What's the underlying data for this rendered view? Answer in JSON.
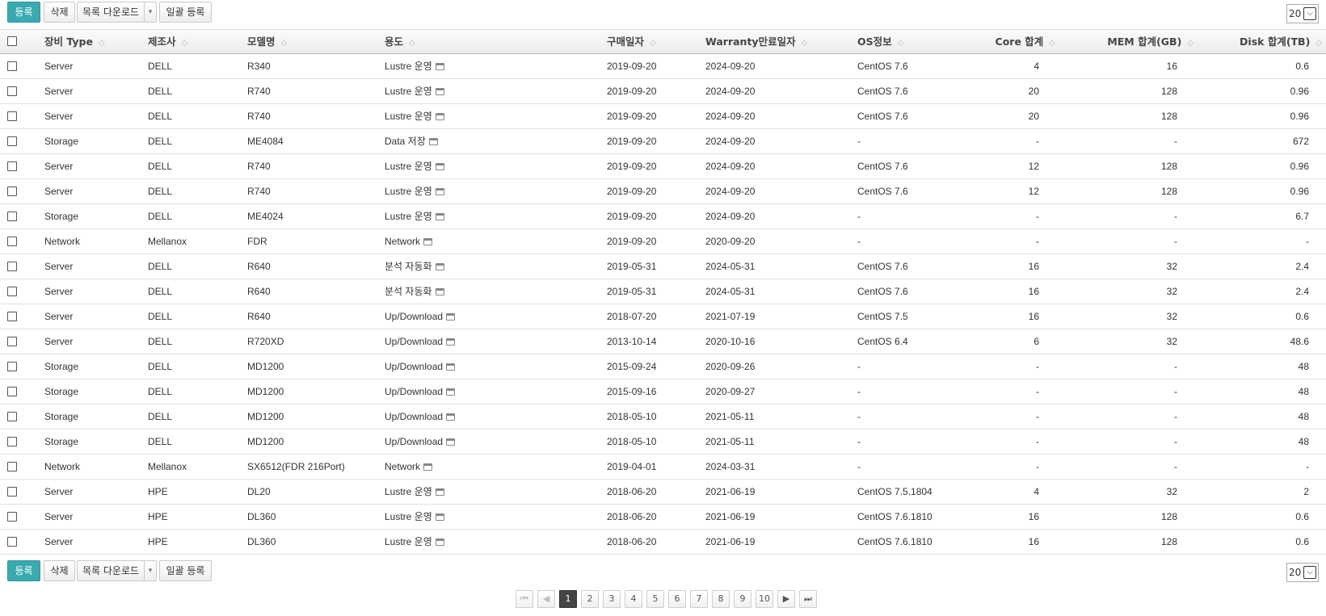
{
  "toolbar": {
    "register_label": "등록",
    "delete_label": "삭제",
    "download_label": "목록 다운로드",
    "download_caret": "▾",
    "bulk_label": "일괄 등록",
    "page_size": "20",
    "page_size_arrow": "⌵"
  },
  "table": {
    "sort_icon": "◇",
    "headers": {
      "type": "장비 Type",
      "maker": "제조사",
      "model": "모델명",
      "usage": "용도",
      "purchase": "구매일자",
      "warranty": "Warranty만료일자",
      "os": "OS정보",
      "core": "Core 합계",
      "mem": "MEM 합계(GB)",
      "disk": "Disk 합계(TB)"
    },
    "rows": [
      {
        "type": "Server",
        "maker": "DELL",
        "model": "R340",
        "usage": "Lustre 운영",
        "purchase": "2019-09-20",
        "warranty": "2024-09-20",
        "os": "CentOS 7.6",
        "core": "4",
        "mem": "16",
        "disk": "0.6"
      },
      {
        "type": "Server",
        "maker": "DELL",
        "model": "R740",
        "usage": "Lustre 운영",
        "purchase": "2019-09-20",
        "warranty": "2024-09-20",
        "os": "CentOS 7.6",
        "core": "20",
        "mem": "128",
        "disk": "0.96"
      },
      {
        "type": "Server",
        "maker": "DELL",
        "model": "R740",
        "usage": "Lustre 운영",
        "purchase": "2019-09-20",
        "warranty": "2024-09-20",
        "os": "CentOS 7.6",
        "core": "20",
        "mem": "128",
        "disk": "0.96"
      },
      {
        "type": "Storage",
        "maker": "DELL",
        "model": "ME4084",
        "usage": "Data 저장",
        "purchase": "2019-09-20",
        "warranty": "2024-09-20",
        "os": "-",
        "core": "-",
        "mem": "-",
        "disk": "672"
      },
      {
        "type": "Server",
        "maker": "DELL",
        "model": "R740",
        "usage": "Lustre 운영",
        "purchase": "2019-09-20",
        "warranty": "2024-09-20",
        "os": "CentOS 7.6",
        "core": "12",
        "mem": "128",
        "disk": "0.96"
      },
      {
        "type": "Server",
        "maker": "DELL",
        "model": "R740",
        "usage": "Lustre 운영",
        "purchase": "2019-09-20",
        "warranty": "2024-09-20",
        "os": "CentOS 7.6",
        "core": "12",
        "mem": "128",
        "disk": "0.96"
      },
      {
        "type": "Storage",
        "maker": "DELL",
        "model": "ME4024",
        "usage": "Lustre 운영",
        "purchase": "2019-09-20",
        "warranty": "2024-09-20",
        "os": "-",
        "core": "-",
        "mem": "-",
        "disk": "6.7"
      },
      {
        "type": "Network",
        "maker": "Mellanox",
        "model": "FDR",
        "usage": "Network",
        "purchase": "2019-09-20",
        "warranty": "2020-09-20",
        "os": "-",
        "core": "-",
        "mem": "-",
        "disk": "-"
      },
      {
        "type": "Server",
        "maker": "DELL",
        "model": "R640",
        "usage": "분석 자동화",
        "purchase": "2019-05-31",
        "warranty": "2024-05-31",
        "os": "CentOS 7.6",
        "core": "16",
        "mem": "32",
        "disk": "2.4"
      },
      {
        "type": "Server",
        "maker": "DELL",
        "model": "R640",
        "usage": "분석 자동화",
        "purchase": "2019-05-31",
        "warranty": "2024-05-31",
        "os": "CentOS 7.6",
        "core": "16",
        "mem": "32",
        "disk": "2.4"
      },
      {
        "type": "Server",
        "maker": "DELL",
        "model": "R640",
        "usage": "Up/Download",
        "purchase": "2018-07-20",
        "warranty": "2021-07-19",
        "os": "CentOS 7.5",
        "core": "16",
        "mem": "32",
        "disk": "0.6"
      },
      {
        "type": "Server",
        "maker": "DELL",
        "model": "R720XD",
        "usage": "Up/Download",
        "purchase": "2013-10-14",
        "warranty": "2020-10-16",
        "os": "CentOS 6.4",
        "core": "6",
        "mem": "32",
        "disk": "48.6"
      },
      {
        "type": "Storage",
        "maker": "DELL",
        "model": "MD1200",
        "usage": "Up/Download",
        "purchase": "2015-09-24",
        "warranty": "2020-09-26",
        "os": "-",
        "core": "-",
        "mem": "-",
        "disk": "48"
      },
      {
        "type": "Storage",
        "maker": "DELL",
        "model": "MD1200",
        "usage": "Up/Download",
        "purchase": "2015-09-16",
        "warranty": "2020-09-27",
        "os": "-",
        "core": "-",
        "mem": "-",
        "disk": "48"
      },
      {
        "type": "Storage",
        "maker": "DELL",
        "model": "MD1200",
        "usage": "Up/Download",
        "purchase": "2018-05-10",
        "warranty": "2021-05-11",
        "os": "-",
        "core": "-",
        "mem": "-",
        "disk": "48"
      },
      {
        "type": "Storage",
        "maker": "DELL",
        "model": "MD1200",
        "usage": "Up/Download",
        "purchase": "2018-05-10",
        "warranty": "2021-05-11",
        "os": "-",
        "core": "-",
        "mem": "-",
        "disk": "48"
      },
      {
        "type": "Network",
        "maker": "Mellanox",
        "model": "SX6512(FDR 216Port)",
        "usage": "Network",
        "purchase": "2019-04-01",
        "warranty": "2024-03-31",
        "os": "-",
        "core": "-",
        "mem": "-",
        "disk": "-"
      },
      {
        "type": "Server",
        "maker": "HPE",
        "model": "DL20",
        "usage": "Lustre 운영",
        "purchase": "2018-06-20",
        "warranty": "2021-06-19",
        "os": "CentOS 7.5.1804",
        "core": "4",
        "mem": "32",
        "disk": "2"
      },
      {
        "type": "Server",
        "maker": "HPE",
        "model": "DL360",
        "usage": "Lustre 운영",
        "purchase": "2018-06-20",
        "warranty": "2021-06-19",
        "os": "CentOS 7.6.1810",
        "core": "16",
        "mem": "128",
        "disk": "0.6"
      },
      {
        "type": "Server",
        "maker": "HPE",
        "model": "DL360",
        "usage": "Lustre 운영",
        "purchase": "2018-06-20",
        "warranty": "2021-06-19",
        "os": "CentOS 7.6.1810",
        "core": "16",
        "mem": "128",
        "disk": "0.6"
      }
    ]
  },
  "pagination": {
    "first": "⏮",
    "prev": "◀",
    "next": "▶",
    "last": "⏭",
    "pages": [
      "1",
      "2",
      "3",
      "4",
      "5",
      "6",
      "7",
      "8",
      "9",
      "10"
    ],
    "current": "1"
  }
}
